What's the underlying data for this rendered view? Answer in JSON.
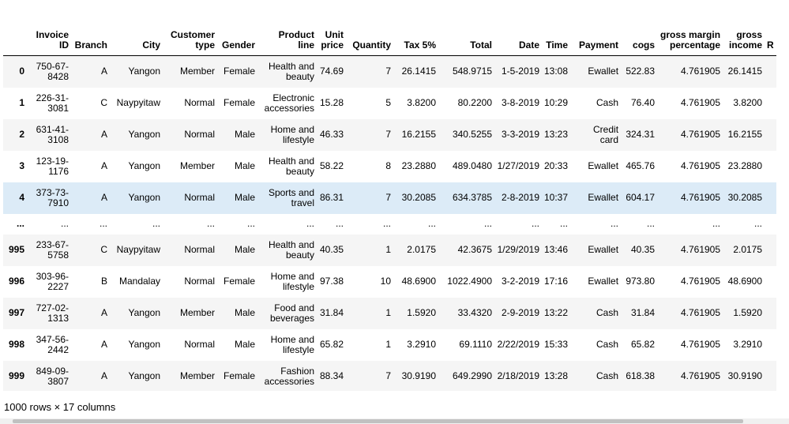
{
  "columns": [
    "",
    "Invoice ID",
    "Branch",
    "City",
    "Customer type",
    "Gender",
    "Product line",
    "Unit price",
    "Quantity",
    "Tax 5%",
    "Total",
    "Date",
    "Time",
    "Payment",
    "cogs",
    "gross margin percentage",
    "gross income",
    "R"
  ],
  "rows": [
    [
      "0",
      "750-67-8428",
      "A",
      "Yangon",
      "Member",
      "Female",
      "Health and beauty",
      "74.69",
      "7",
      "26.1415",
      "548.9715",
      "1-5-2019",
      "13:08",
      "Ewallet",
      "522.83",
      "4.761905",
      "26.1415"
    ],
    [
      "1",
      "226-31-3081",
      "C",
      "Naypyitaw",
      "Normal",
      "Female",
      "Electronic accessories",
      "15.28",
      "5",
      "3.8200",
      "80.2200",
      "3-8-2019",
      "10:29",
      "Cash",
      "76.40",
      "4.761905",
      "3.8200"
    ],
    [
      "2",
      "631-41-3108",
      "A",
      "Yangon",
      "Normal",
      "Male",
      "Home and lifestyle",
      "46.33",
      "7",
      "16.2155",
      "340.5255",
      "3-3-2019",
      "13:23",
      "Credit card",
      "324.31",
      "4.761905",
      "16.2155"
    ],
    [
      "3",
      "123-19-1176",
      "A",
      "Yangon",
      "Member",
      "Male",
      "Health and beauty",
      "58.22",
      "8",
      "23.2880",
      "489.0480",
      "1/27/2019",
      "20:33",
      "Ewallet",
      "465.76",
      "4.761905",
      "23.2880"
    ],
    [
      "4",
      "373-73-7910",
      "A",
      "Yangon",
      "Normal",
      "Male",
      "Sports and travel",
      "86.31",
      "7",
      "30.2085",
      "634.3785",
      "2-8-2019",
      "10:37",
      "Ewallet",
      "604.17",
      "4.761905",
      "30.2085"
    ],
    [
      "...",
      "...",
      "...",
      "...",
      "...",
      "...",
      "...",
      "...",
      "...",
      "...",
      "...",
      "...",
      "...",
      "...",
      "...",
      "...",
      "..."
    ],
    [
      "995",
      "233-67-5758",
      "C",
      "Naypyitaw",
      "Normal",
      "Male",
      "Health and beauty",
      "40.35",
      "1",
      "2.0175",
      "42.3675",
      "1/29/2019",
      "13:46",
      "Ewallet",
      "40.35",
      "4.761905",
      "2.0175"
    ],
    [
      "996",
      "303-96-2227",
      "B",
      "Mandalay",
      "Normal",
      "Female",
      "Home and lifestyle",
      "97.38",
      "10",
      "48.6900",
      "1022.4900",
      "3-2-2019",
      "17:16",
      "Ewallet",
      "973.80",
      "4.761905",
      "48.6900"
    ],
    [
      "997",
      "727-02-1313",
      "A",
      "Yangon",
      "Member",
      "Male",
      "Food and beverages",
      "31.84",
      "1",
      "1.5920",
      "33.4320",
      "2-9-2019",
      "13:22",
      "Cash",
      "31.84",
      "4.761905",
      "1.5920"
    ],
    [
      "998",
      "347-56-2442",
      "A",
      "Yangon",
      "Normal",
      "Male",
      "Home and lifestyle",
      "65.82",
      "1",
      "3.2910",
      "69.1110",
      "2/22/2019",
      "15:33",
      "Cash",
      "65.82",
      "4.761905",
      "3.2910"
    ],
    [
      "999",
      "849-09-3807",
      "A",
      "Yangon",
      "Member",
      "Female",
      "Fashion accessories",
      "88.34",
      "7",
      "30.9190",
      "649.2990",
      "2/18/2019",
      "13:28",
      "Cash",
      "618.38",
      "4.761905",
      "30.9190"
    ]
  ],
  "highlighted_row": "4",
  "footer": "1000 rows × 17 columns"
}
